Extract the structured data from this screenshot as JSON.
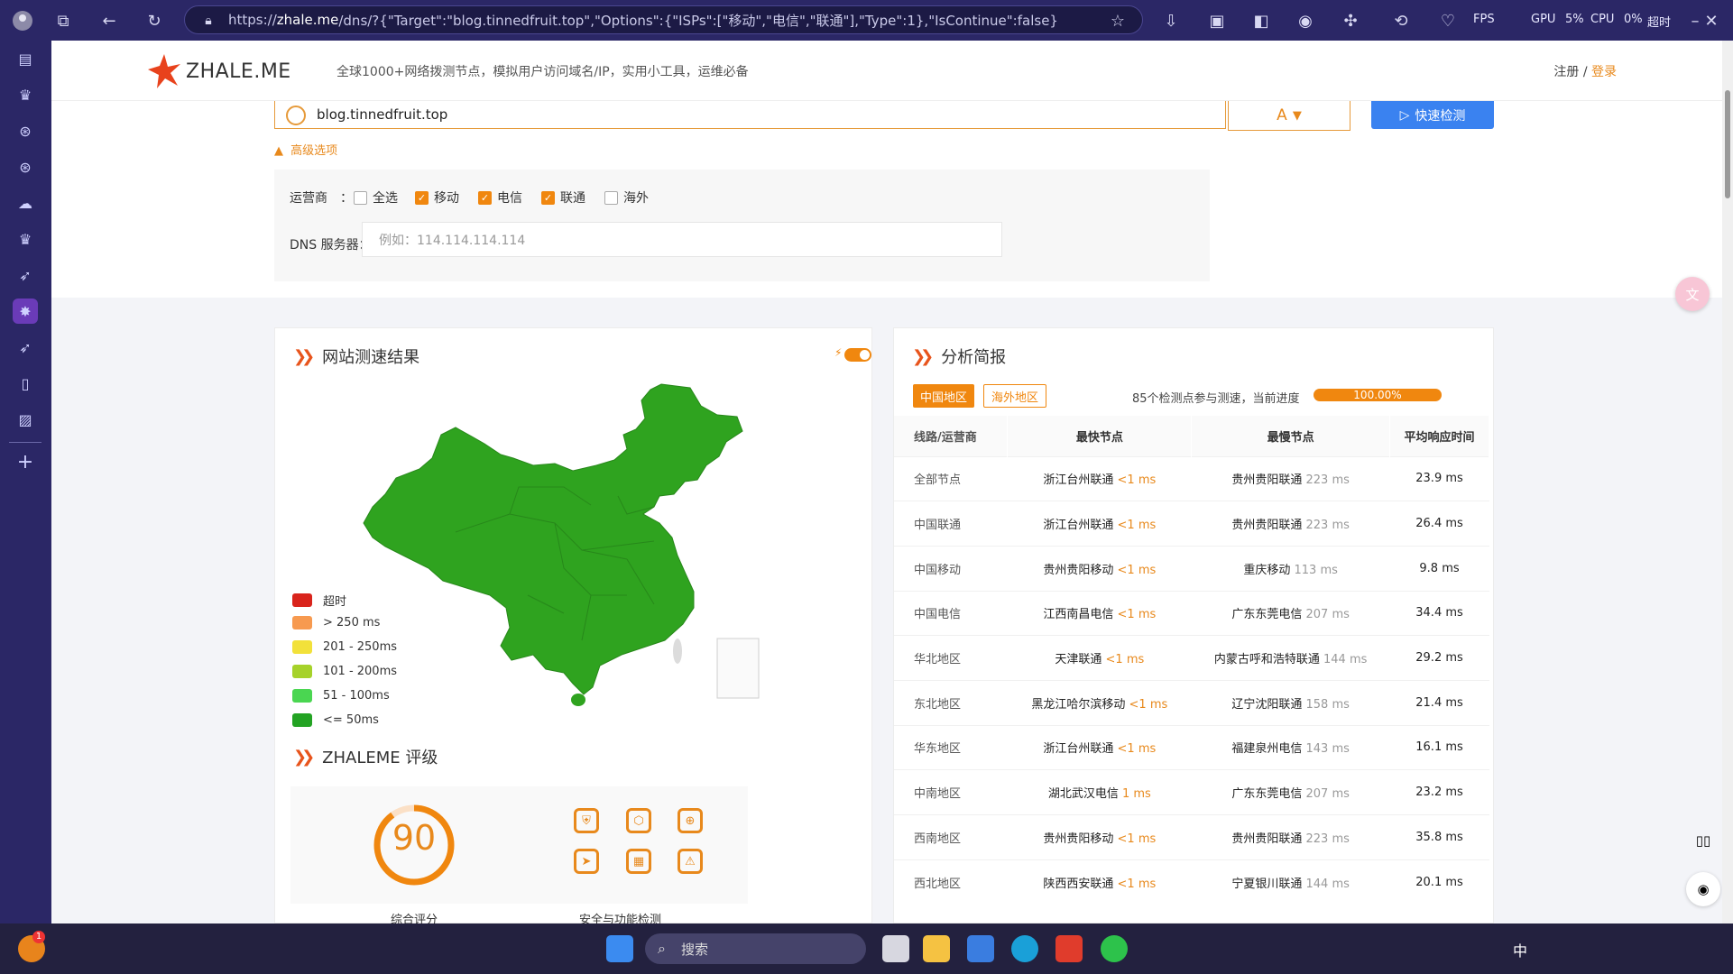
{
  "browser": {
    "url_prefix": "https://",
    "url_host": "zhale.me",
    "url_rest": "/dns/?{\"Target\":\"blog.tinnedfruit.top\",\"Options\":{\"ISPs\":[\"移动\",\"电信\",\"联通\"],\"Type\":1},\"IsContinue\":false}",
    "fps_label": "FPS",
    "gpu_label": "GPU",
    "gpu_value": "5%",
    "cpu_label": "CPU",
    "cpu_value": "0%",
    "timeout_label": "超时"
  },
  "site": {
    "logo": "ZHALE.ME",
    "tagline": "全球1000+网络拨测节点，模拟用户访问域名/IP，实用小工具，运维必备",
    "register": "注册",
    "separator": "/",
    "login": "登录"
  },
  "search": {
    "domain": "blog.tinnedfruit.top",
    "record_type": "A",
    "check_button": "快速检测",
    "advanced": "高级选项"
  },
  "options": {
    "isp_label": "运营商",
    "colon": "：",
    "checkboxes": [
      {
        "label": "全选",
        "checked": false
      },
      {
        "label": "移动",
        "checked": true
      },
      {
        "label": "电信",
        "checked": true
      },
      {
        "label": "联通",
        "checked": true
      },
      {
        "label": "海外",
        "checked": false
      }
    ],
    "dns_label": "DNS 服务器：",
    "dns_placeholder": "例如：114.114.114.114"
  },
  "results": {
    "title": "网站测速结果",
    "legend": [
      {
        "label": "超时",
        "color": "#d9241c"
      },
      {
        "label": "> 250 ms",
        "color": "#f79a50"
      },
      {
        "label": "201 - 250ms",
        "color": "#f2e13a"
      },
      {
        "label": "101 - 200ms",
        "color": "#a6d22a"
      },
      {
        "label": "51 - 100ms",
        "color": "#4ad651"
      },
      {
        "label": "<= 50ms",
        "color": "#23a323"
      }
    ],
    "map_color": "#2fa31f"
  },
  "rating": {
    "title": "ZHALEME 评级",
    "score": "90",
    "score_fraction": 0.9,
    "score_label": "综合评分",
    "security_label": "安全与功能检测"
  },
  "analysis": {
    "title": "分析简报",
    "tab_china": "中国地区",
    "tab_overseas": "海外地区",
    "progress_text": "85个检测点参与测速，当前进度",
    "progress_value": "100.00%",
    "headers": [
      "线路/运营商",
      "最快节点",
      "最慢节点",
      "平均响应时间"
    ],
    "rows": [
      {
        "line": "全部节点",
        "fast": "浙江台州联通",
        "fast_ms": "<1 ms",
        "slow": "贵州贵阳联通",
        "slow_ms": "223 ms",
        "avg": "23.9 ms"
      },
      {
        "line": "中国联通",
        "fast": "浙江台州联通",
        "fast_ms": "<1 ms",
        "slow": "贵州贵阳联通",
        "slow_ms": "223 ms",
        "avg": "26.4 ms"
      },
      {
        "line": "中国移动",
        "fast": "贵州贵阳移动",
        "fast_ms": "<1 ms",
        "slow": "重庆移动",
        "slow_ms": "113 ms",
        "avg": "9.8 ms"
      },
      {
        "line": "中国电信",
        "fast": "江西南昌电信",
        "fast_ms": "<1 ms",
        "slow": "广东东莞电信",
        "slow_ms": "207 ms",
        "avg": "34.4 ms"
      },
      {
        "line": "华北地区",
        "fast": "天津联通",
        "fast_ms": "<1 ms",
        "slow": "内蒙古呼和浩特联通",
        "slow_ms": "144 ms",
        "avg": "29.2 ms"
      },
      {
        "line": "东北地区",
        "fast": "黑龙江哈尔滨移动",
        "fast_ms": "<1 ms",
        "slow": "辽宁沈阳联通",
        "slow_ms": "158 ms",
        "avg": "21.4 ms"
      },
      {
        "line": "华东地区",
        "fast": "浙江台州联通",
        "fast_ms": "<1 ms",
        "slow": "福建泉州电信",
        "slow_ms": "143 ms",
        "avg": "16.1 ms"
      },
      {
        "line": "中南地区",
        "fast": "湖北武汉电信",
        "fast_ms": "1 ms",
        "slow": "广东东莞电信",
        "slow_ms": "207 ms",
        "avg": "23.2 ms"
      },
      {
        "line": "西南地区",
        "fast": "贵州贵阳移动",
        "fast_ms": "<1 ms",
        "slow": "贵州贵阳联通",
        "slow_ms": "223 ms",
        "avg": "35.8 ms"
      },
      {
        "line": "西北地区",
        "fast": "陕西西安联通",
        "fast_ms": "<1 ms",
        "slow": "宁夏银川联通",
        "slow_ms": "144 ms",
        "avg": "20.1 ms"
      }
    ]
  },
  "taskbar": {
    "search": "搜索",
    "ime": "中",
    "notify_count": "1"
  }
}
